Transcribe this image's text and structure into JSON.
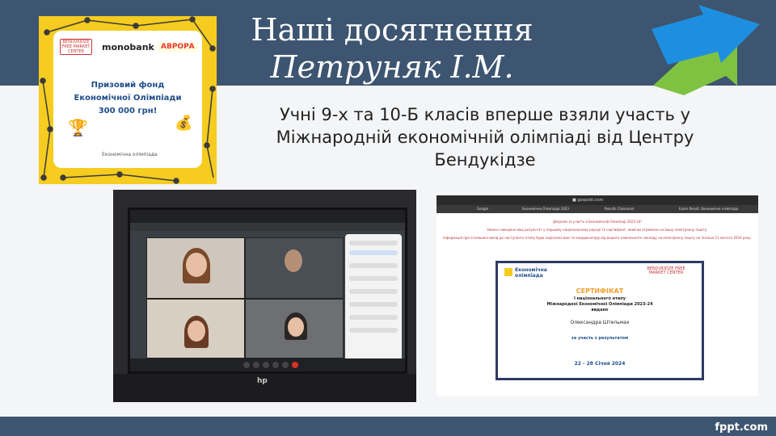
{
  "colors": {
    "band": "#3d5570",
    "accent": "#f5cc1f",
    "arrow_blue": "#1e8fe0",
    "arrow_green": "#7fc241"
  },
  "slide": {
    "title_line1": "Наші досягнення",
    "title_line2": "Петруняк І.М.",
    "body": "Учні 9-х та 10-Б класів вперше взяли участь у Міжнародній економічній олімпіаді від Центру Бендукідзе",
    "footer_brand": "fppt.com"
  },
  "promo": {
    "logo_bfm": "BENDUKIDZE FREE MARKET CENTER",
    "logo_mono": "monobank",
    "logo_avrora": "АВРОРА",
    "line1": "Призовий фонд",
    "line2": "Економічної Олімпіади",
    "line3": "300 000 грн!",
    "footer": "Економічна олімпіада",
    "icons": [
      "trophy-icon",
      "money-bag-icon"
    ]
  },
  "laptop": {
    "brand": "hp"
  },
  "certificate": {
    "url": "■ gospodi.com",
    "tabs": [
      "Google",
      "Економічна Олімпіада 2023",
      "Results Classroom",
      "Exam Result: Економічна олімпіада"
    ],
    "intro_1": "Дякуємо за участь в Економічній Олімпіаді 2023-24!",
    "intro_2": "Нижче наведено ваш результат у першому національному раунді та сертифікат, який ви отримали на вашу електронну пошту.",
    "intro_3": "Інформація про оголошені вихід до наступного етапу буде надіслана вам та координатору від вашого навчального закладу на електронну пошту не пізніше 11 лютого 2024 року.",
    "logo_ec": "Економічна олімпіада",
    "logo_bfm": "BENDUKIDZE FREE MARKET CENTER",
    "title": "СЕРТИФІКАТ",
    "line1": "I національного етапу",
    "line2": "Міжнародної Економічної Олімпіади 2023-24",
    "line3": "видано",
    "name": "Олександра Штельмах",
    "result": "за участь з результатом",
    "dates": "22 - 28 Січня 2024"
  }
}
